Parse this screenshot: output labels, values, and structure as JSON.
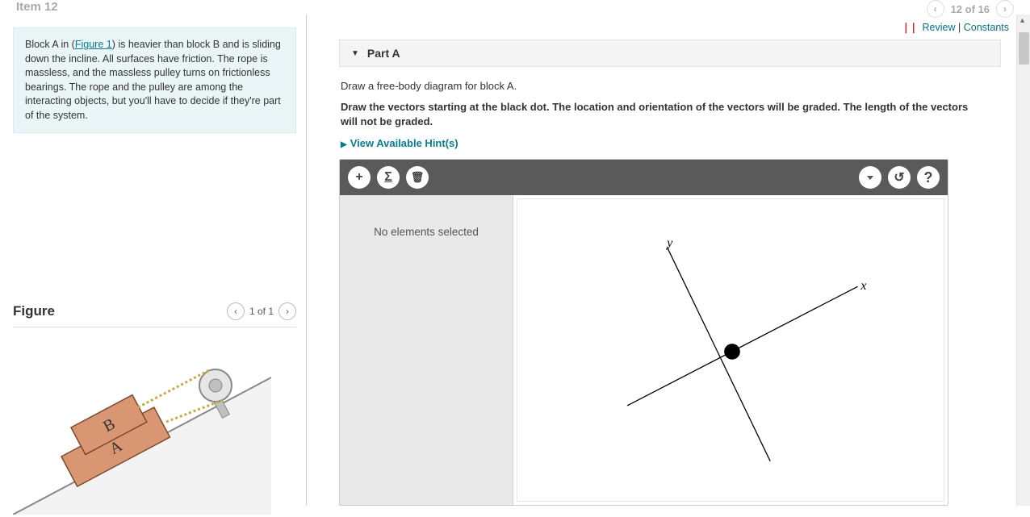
{
  "header": {
    "item_label": "Item 12",
    "progress": "12 of 16"
  },
  "problem": {
    "text_pre": "Block A in (",
    "figure_link": "Figure 1",
    "text_post": ") is heavier than block B and is sliding down the incline. All surfaces have friction. The rope is massless, and the massless pulley turns on frictionless bearings. The rope and the pulley are among the interacting objects, but you'll have to decide if they're part of the system."
  },
  "figure": {
    "title": "Figure",
    "counter": "1 of 1",
    "block_a_label": "A",
    "block_b_label": "B"
  },
  "review": {
    "review_label": "Review",
    "constants_label": "Constants"
  },
  "part": {
    "label": "Part A",
    "instruction1": "Draw a free-body diagram for block A.",
    "instruction2": "Draw the vectors starting at the black dot. The location and orientation of the vectors will be graded. The length of the vectors will not be graded.",
    "hints_label": "View Available Hint(s)"
  },
  "canvas": {
    "no_selection": "No elements selected",
    "axis_y": "y",
    "axis_x": "x"
  },
  "toolbar": {
    "add": "+",
    "sum": "Σ",
    "trash": "🗑",
    "reset": "↺",
    "help": "?"
  }
}
